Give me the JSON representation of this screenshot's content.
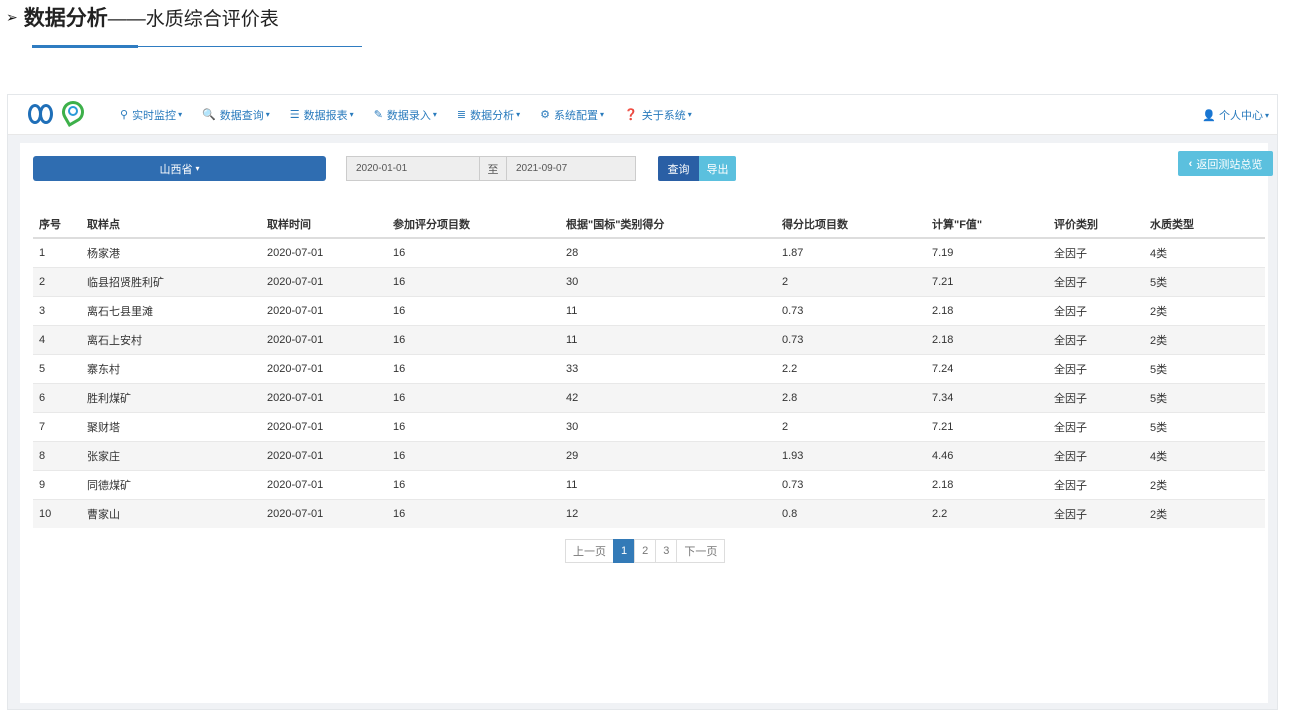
{
  "heading": {
    "arrow": "➢",
    "bold": "数据分析",
    "rest": "——水质综合评价表"
  },
  "navbar": {
    "items": [
      {
        "label": "实时监控",
        "icon": "map-marker-icon",
        "glyph": "⚲"
      },
      {
        "label": "数据查询",
        "icon": "search-icon",
        "glyph": "🔍"
      },
      {
        "label": "数据报表",
        "icon": "list-icon",
        "glyph": "☰"
      },
      {
        "label": "数据录入",
        "icon": "edit-icon",
        "glyph": "✎"
      },
      {
        "label": "数据分析",
        "icon": "storage-icon",
        "glyph": "≣"
      },
      {
        "label": "系统配置",
        "icon": "gear-icon",
        "glyph": "⚙"
      },
      {
        "label": "关于系统",
        "icon": "question-circle-icon",
        "glyph": "❓"
      }
    ],
    "user": {
      "label": "个人中心",
      "icon": "user-icon"
    }
  },
  "filters": {
    "province": "山西省",
    "start_date": "2020-01-01",
    "separator": "至",
    "end_date": "2021-09-07",
    "query": "查询",
    "export": "导出",
    "back": "返回测站总览"
  },
  "table": {
    "headers": [
      "序号",
      "取样点",
      "取样时间",
      "参加评分项目数",
      "根据\"国标\"类别得分",
      "得分比项目数",
      "计算\"F值\"",
      "评价类别",
      "水质类型"
    ],
    "rows": [
      [
        "1",
        "杨家港",
        "2020-07-01",
        "16",
        "28",
        "1.87",
        "7.19",
        "全因子",
        "4类"
      ],
      [
        "2",
        "临县招贤胜利矿",
        "2020-07-01",
        "16",
        "30",
        "2",
        "7.21",
        "全因子",
        "5类"
      ],
      [
        "3",
        "离石七县里滩",
        "2020-07-01",
        "16",
        "11",
        "0.73",
        "2.18",
        "全因子",
        "2类"
      ],
      [
        "4",
        "离石上安村",
        "2020-07-01",
        "16",
        "11",
        "0.73",
        "2.18",
        "全因子",
        "2类"
      ],
      [
        "5",
        "寨东村",
        "2020-07-01",
        "16",
        "33",
        "2.2",
        "7.24",
        "全因子",
        "5类"
      ],
      [
        "6",
        "胜利煤矿",
        "2020-07-01",
        "16",
        "42",
        "2.8",
        "7.34",
        "全因子",
        "5类"
      ],
      [
        "7",
        "聚财塔",
        "2020-07-01",
        "16",
        "30",
        "2",
        "7.21",
        "全因子",
        "5类"
      ],
      [
        "8",
        "张家庄",
        "2020-07-01",
        "16",
        "29",
        "1.93",
        "4.46",
        "全因子",
        "4类"
      ],
      [
        "9",
        "同德煤矿",
        "2020-07-01",
        "16",
        "11",
        "0.73",
        "2.18",
        "全因子",
        "2类"
      ],
      [
        "10",
        "曹家山",
        "2020-07-01",
        "16",
        "12",
        "0.8",
        "2.2",
        "全因子",
        "2类"
      ]
    ]
  },
  "pagination": {
    "prev": "上一页",
    "pages": [
      "1",
      "2",
      "3"
    ],
    "current": "1",
    "next": "下一页"
  }
}
